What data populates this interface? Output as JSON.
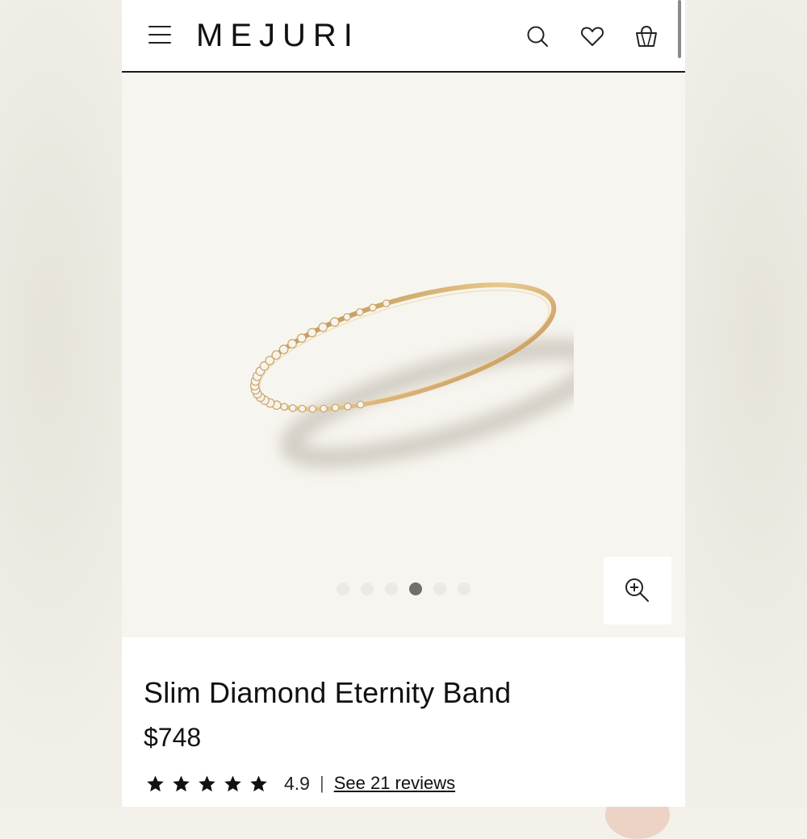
{
  "header": {
    "logo": "MEJURI",
    "menu_icon": "hamburger-menu-icon",
    "search_icon": "search-icon",
    "wishlist_icon": "heart-icon",
    "bag_icon": "shopping-bag-icon"
  },
  "gallery": {
    "image": "Slim diamond eternity band, yellow gold, on cream background",
    "total_images": 6,
    "active_index": 4,
    "zoom_icon": "zoom-in-icon"
  },
  "product": {
    "title": "Slim Diamond Eternity Band",
    "price": "$748",
    "rating": "4.9",
    "rating_stars": 5,
    "separator": "|",
    "reviews_link": "See 21 reviews"
  },
  "colors": {
    "text": "#111111",
    "gold": "#d2a766",
    "background": "#f7f5ef",
    "active_dot": "#6f6f6f"
  }
}
